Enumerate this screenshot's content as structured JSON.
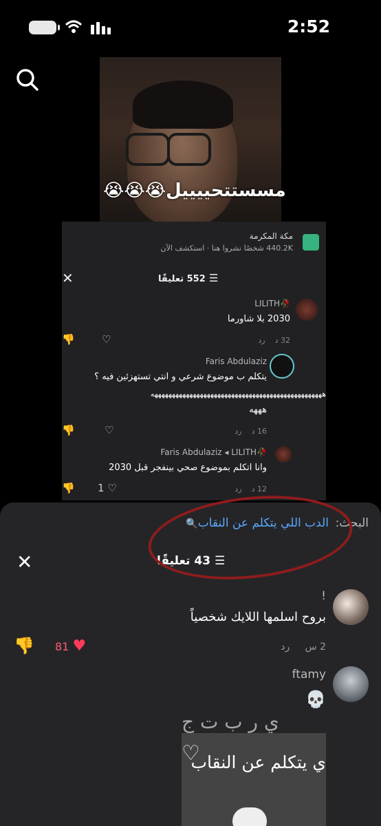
{
  "status_bar": {
    "time": "2:52"
  },
  "video": {
    "caption": "مسستتحييييل😭😭😭"
  },
  "inner": {
    "location_title": "مكة المكرمة",
    "location_subtitle": "440.2K شخصًا نشروا هنا · استكشف الآن",
    "comment_count": "552 تعليقًا",
    "comments": [
      {
        "name": "LILITH🥀",
        "text": "2030 بلا شاورما",
        "time": "32 د",
        "reply": "رد"
      },
      {
        "name": "Faris Abdulaziz",
        "text": "يتكلم ب موضوع شرعي و انتي تستهزئين فيه ؟",
        "laugh": "هههههههههههههههههههههههههههههههههههههههههههههههههه",
        "laugh2": "هههه",
        "time": "16 د",
        "reply": "رد"
      },
      {
        "name": "Faris Abdulaziz ◂ LILITH🥀",
        "text": "وانا اتكلم بموضوع صحي بينفجر قبل 2030",
        "time": "12 د",
        "reply": "رد",
        "likes": "1"
      }
    ]
  },
  "sheet": {
    "search_label": "البحث:",
    "search_query": "الدب اللي يتكلم عن النقاب",
    "comment_count": "43 تعليقًا",
    "comments": [
      {
        "name": "!",
        "text": "بروح اسلمها اللايك شخصياً",
        "time": "2 س",
        "reply": "رد",
        "likes": "81"
      },
      {
        "name": "ftamy",
        "text": "💀"
      }
    ],
    "reply_thumb_text": "ي يتكلم عن النقاب",
    "faded_text": "ي  ر  ب  ت  ج  "
  },
  "icons": [
    "search-icon",
    "close-icon",
    "filter-icon",
    "heart-icon",
    "dislike-icon",
    "location-icon",
    "wifi-icon",
    "signal-icon",
    "battery-icon"
  ]
}
